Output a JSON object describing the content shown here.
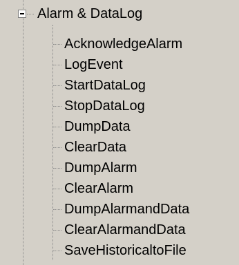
{
  "tree": {
    "root": {
      "label": "Alarm & DataLog",
      "expanded": true
    },
    "children": [
      {
        "label": "AcknowledgeAlarm"
      },
      {
        "label": "LogEvent"
      },
      {
        "label": "StartDataLog"
      },
      {
        "label": "StopDataLog"
      },
      {
        "label": "DumpData"
      },
      {
        "label": "ClearData"
      },
      {
        "label": "DumpAlarm"
      },
      {
        "label": "ClearAlarm"
      },
      {
        "label": "DumpAlarmandData"
      },
      {
        "label": "ClearAlarmandData"
      },
      {
        "label": "SaveHistoricaltoFile"
      }
    ]
  }
}
